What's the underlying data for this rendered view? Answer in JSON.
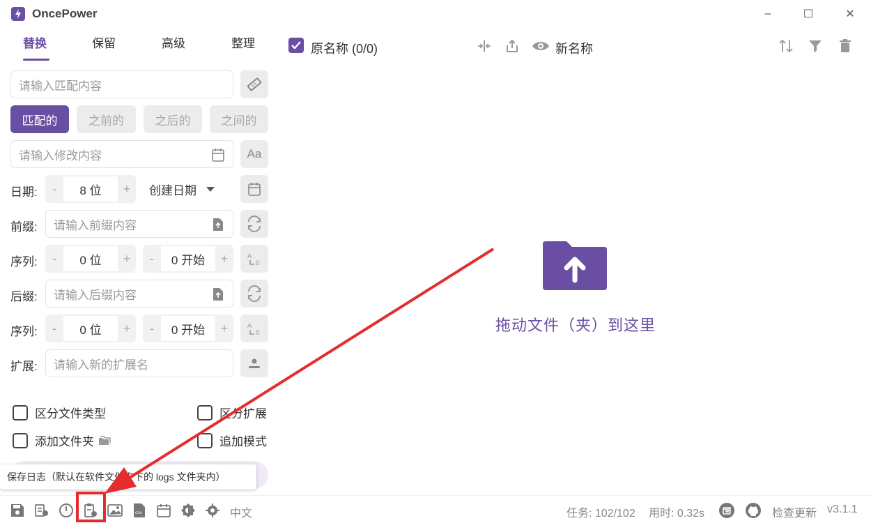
{
  "app": {
    "title": "OncePower"
  },
  "window": {
    "minimize": "–",
    "maximize": "☐",
    "close": "✕"
  },
  "tabs": [
    {
      "label": "替换",
      "active": true
    },
    {
      "label": "保留",
      "active": false
    },
    {
      "label": "高级",
      "active": false
    },
    {
      "label": "整理",
      "active": false
    }
  ],
  "match": {
    "placeholder": "请输入匹配内容"
  },
  "modes": [
    {
      "label": "匹配的",
      "active": true
    },
    {
      "label": "之前的",
      "active": false
    },
    {
      "label": "之后的",
      "active": false
    },
    {
      "label": "之间的",
      "active": false
    }
  ],
  "modify": {
    "placeholder": "请输入修改内容"
  },
  "date": {
    "label": "日期:",
    "minus": "-",
    "value": "8 位",
    "plus": "+",
    "type": "创建日期"
  },
  "prefix": {
    "label": "前缀:",
    "placeholder": "请输入前缀内容"
  },
  "seq1": {
    "label": "序列:",
    "minus": "-",
    "digits": "0 位",
    "plus": "+",
    "start": "0 开始"
  },
  "suffix": {
    "label": "后缀:",
    "placeholder": "请输入后缀内容"
  },
  "seq2": {
    "label": "序列:",
    "minus": "-",
    "digits": "0 位",
    "plus": "+",
    "start": "0 开始"
  },
  "ext": {
    "label": "扩展:",
    "placeholder": "请输入新的扩展名"
  },
  "options": {
    "distinguish_type": "区分文件类型",
    "distinguish_ext": "区分扩展",
    "add_folder": "添加文件夹",
    "append_mode": "追加模式"
  },
  "tooltip": "保存日志（默认在软件文件夹下的 logs 文件夹内）",
  "main": {
    "original_name": "原名称 (0/0)",
    "new_name": "新名称",
    "drop_text": "拖动文件（夹）到这里"
  },
  "bottom": {
    "lang": "中文",
    "tasks": "任务: 102/102",
    "time": "用时: 0.32s",
    "check_update": "检查更新",
    "version": "v3.1.1"
  },
  "colors": {
    "accent": "#6a4ea4",
    "annotation": "#e52d2d"
  }
}
